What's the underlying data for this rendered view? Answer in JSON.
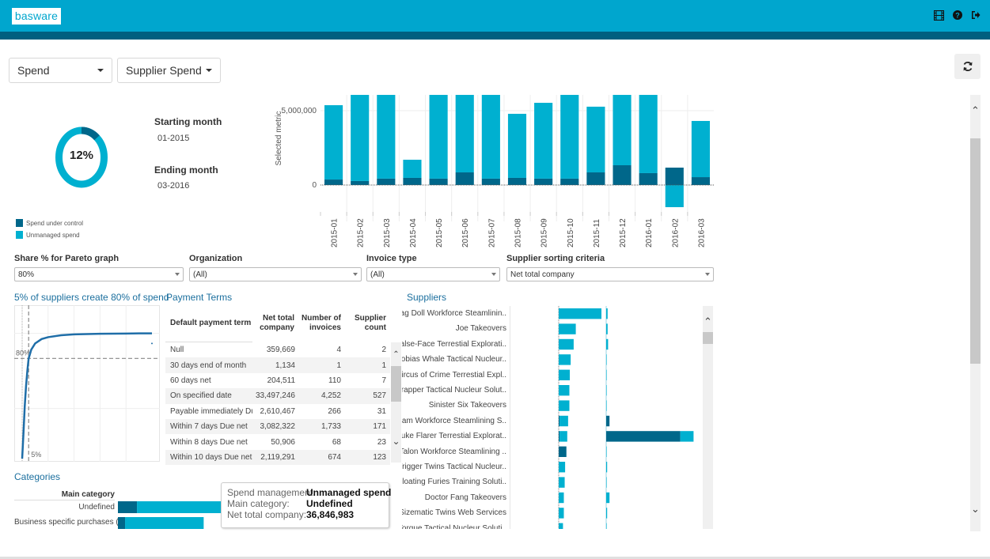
{
  "header": {
    "logo_text": "basware",
    "icons": [
      "film-icon",
      "help-icon",
      "logout-icon"
    ]
  },
  "toolbar": {
    "metric_dropdown": "Spend",
    "view_dropdown": "Supplier Spend",
    "refresh_icon": "refresh-icon"
  },
  "colors": {
    "brand": "#00a6ce",
    "brand_dark": "#005f7f",
    "spend_under_control": "#00678a",
    "unmanaged_spend": "#00b0d0",
    "title_blue": "#1b6f9e"
  },
  "summary": {
    "donut_percent_label": "12%",
    "donut_share": 0.12,
    "starting_month_label": "Starting month",
    "starting_month": "01-2015",
    "ending_month_label": "Ending month",
    "ending_month": "03-2016",
    "legend": [
      {
        "label": "Spend under control",
        "color": "#00678a"
      },
      {
        "label": "Unmanaged spend",
        "color": "#00b0d0"
      }
    ]
  },
  "chart_data": [
    {
      "type": "bar",
      "stacked": true,
      "title": "",
      "ylabel": "Selected metric",
      "xlabel": "",
      "ylim": [
        -2000000,
        6060000
      ],
      "yticks": [
        {
          "value": 0,
          "label": "0"
        },
        {
          "value": 5000000,
          "label": "5,000,000"
        }
      ],
      "categories": [
        "2015-01",
        "2015-02",
        "2015-03",
        "2015-04",
        "2015-05",
        "2015-06",
        "2015-07",
        "2015-08",
        "2015-09",
        "2015-10",
        "2015-11",
        "2015-12",
        "2016-01",
        "2016-02",
        "2016-03"
      ],
      "series": [
        {
          "name": "Spend under control",
          "values": [
            370000,
            270000,
            430000,
            480000,
            430000,
            850000,
            430000,
            480000,
            430000,
            430000,
            850000,
            1330000,
            800000,
            1170000,
            530000
          ]
        },
        {
          "name": "Unmanaged spend",
          "values": [
            5000000,
            6200000,
            6200000,
            1220000,
            6200000,
            6200000,
            6200000,
            4310000,
            5100000,
            6200000,
            4420000,
            6200000,
            6200000,
            -1490000,
            3780000
          ]
        }
      ],
      "note": "Bars for 2015-02, 03, 05, 06, 07, 10, 12 and 2016-01 exceed the visible axis top and are clipped"
    },
    {
      "type": "line",
      "title": "5% of suppliers create 80% of spend",
      "xlabel": "",
      "ylabel": "",
      "reference_lines": [
        {
          "axis": "y",
          "value": 80,
          "label": "80%"
        },
        {
          "axis": "x",
          "value": 5,
          "label": "5%"
        }
      ],
      "x": [
        0,
        1,
        2,
        3,
        4,
        5,
        7,
        10,
        15,
        20,
        30,
        40,
        50,
        60,
        70,
        80,
        90,
        100
      ],
      "values": [
        0,
        20,
        42,
        58,
        70,
        80,
        87,
        92,
        95.5,
        97,
        98.5,
        99.2,
        99.5,
        99.7,
        99.8,
        99.9,
        100,
        100
      ],
      "xlim": [
        0,
        100
      ],
      "ylim": [
        0,
        120
      ]
    },
    {
      "type": "bar",
      "orientation": "horizontal",
      "title": "Categories",
      "categories": [
        "Undefined",
        "Business specific purchases (.."
      ],
      "series": [
        {
          "name": "Spend under control",
          "values": [
            8000000,
            3000000
          ]
        },
        {
          "name": "Unmanaged spend",
          "values": [
            36846983,
            33000000
          ]
        }
      ]
    }
  ],
  "filters": [
    {
      "label": "Share % for Pareto graph",
      "value": "80%"
    },
    {
      "label": "Organization",
      "value": "(All)"
    },
    {
      "label": "Invoice type",
      "value": "(All)"
    },
    {
      "label": "Supplier sorting criteria",
      "value": "Net total company"
    }
  ],
  "payment_terms": {
    "title": "Payment Terms",
    "columns": [
      "Default payment term",
      "Net total company",
      "Number of invoices",
      "Supplier count"
    ],
    "rows": [
      [
        "Null",
        "359,669",
        "4",
        "2"
      ],
      [
        "30 days end of month",
        "1,134",
        "1",
        "1"
      ],
      [
        "60 days net",
        "204,511",
        "110",
        "7"
      ],
      [
        "On specified date",
        "33,497,246",
        "4,252",
        "527"
      ],
      [
        "Payable immediately Du..",
        "2,610,467",
        "266",
        "31"
      ],
      [
        "Within 7 days Due net",
        "3,082,322",
        "1,733",
        "171"
      ],
      [
        "Within 8 days Due net",
        "50,906",
        "68",
        "23"
      ],
      [
        "Within 10 days Due net",
        "2,119,291",
        "674",
        "123"
      ]
    ]
  },
  "suppliers": {
    "title": "Suppliers",
    "rows": [
      {
        "name": "Rag Doll Workforce Steamlinin..",
        "spend": 1.0,
        "control": 0.0,
        "share_light": 0.015,
        "share_dark": 0
      },
      {
        "name": "Joe Takeovers",
        "spend": 0.4,
        "control": 0.0,
        "share_light": 0.015,
        "share_dark": 0
      },
      {
        "name": "False-Face Terrestial Explorati..",
        "spend": 0.35,
        "control": 0.0,
        "share_light": 0.02,
        "share_dark": 0
      },
      {
        "name": "Tobias Whale Tactical Nucleur..",
        "spend": 0.28,
        "control": 0.0,
        "share_light": 0.005,
        "share_dark": 0
      },
      {
        "name": "Circus of Crime Terrestial Expl..",
        "spend": 0.26,
        "control": 0.0,
        "share_light": 0.005,
        "share_dark": 0
      },
      {
        "name": "Trapper Tactical Nucleur Solut..",
        "spend": 0.25,
        "control": 0.0,
        "share_light": 0.005,
        "share_dark": 0
      },
      {
        "name": "Sinister Six Takeovers",
        "spend": 0.25,
        "control": 0.0,
        "share_light": 0.005,
        "share_dark": 0
      },
      {
        "name": "Siam Workforce Steamlining S..",
        "spend": 0.22,
        "control": 0.02,
        "share_light": 0.0,
        "share_dark": 0.035
      },
      {
        "name": "Duke Flarer Terrestial Explorat..",
        "spend": 0.2,
        "control": 0.02,
        "share_light": 0.14,
        "share_dark": 0.78
      },
      {
        "name": "Talon Workforce Steamlining ..",
        "spend": 0.18,
        "control": 0.18,
        "share_light": 0.005,
        "share_dark": 0
      },
      {
        "name": "Trigger Twins Tactical Nucleur..",
        "spend": 0.15,
        "control": 0.0,
        "share_light": 0.01,
        "share_dark": 0
      },
      {
        "name": "Floating Furies Training Soluti..",
        "spend": 0.14,
        "control": 0.0,
        "share_light": 0.005,
        "share_dark": 0
      },
      {
        "name": "Doctor Fang Takeovers",
        "spend": 0.12,
        "control": 0.0,
        "share_light": 0.035,
        "share_dark": 0
      },
      {
        "name": "Sizematic Twins Web Services",
        "spend": 0.12,
        "control": 0.0,
        "share_light": 0.01,
        "share_dark": 0
      },
      {
        "name": "Torque Tactical Nucleur Soluti..",
        "spend": 0.1,
        "control": 0.0,
        "share_light": 0.005,
        "share_dark": 0
      }
    ]
  },
  "categories": {
    "title": "Categories",
    "header": "Main category",
    "rows": [
      {
        "name": "Undefined"
      },
      {
        "name": "Business specific purchases (.."
      }
    ]
  },
  "tooltip": {
    "rows": [
      {
        "key": "Spend management:",
        "value": "Unmanaged spend"
      },
      {
        "key": "Main category:",
        "value": "Undefined"
      },
      {
        "key": "Net total company:",
        "value": "36,846,983"
      }
    ]
  }
}
